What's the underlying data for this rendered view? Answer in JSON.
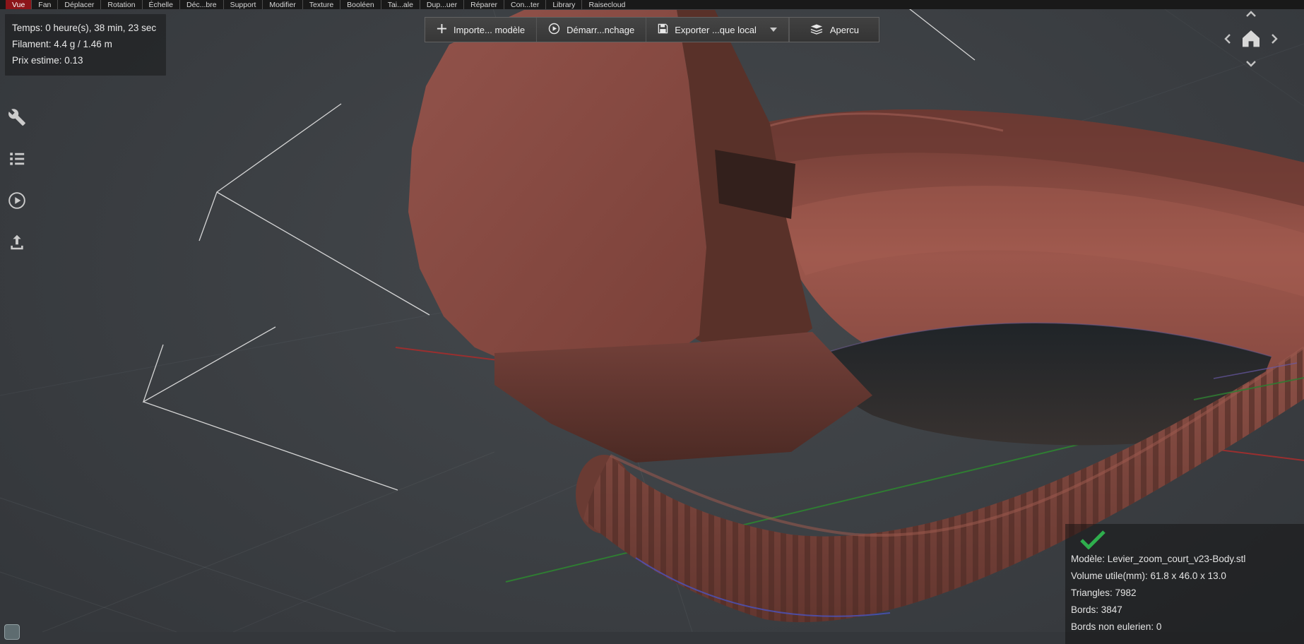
{
  "menu": {
    "items": [
      "Vue",
      "Fan",
      "Déplacer",
      "Rotation",
      "Échelle",
      "Déc...bre",
      "Support",
      "Modifier",
      "Texture",
      "Booléen",
      "Tai...ale",
      "Dup...uer",
      "Réparer",
      "Con...ter",
      "Library",
      "Raisecloud"
    ],
    "active_item": "Vue"
  },
  "stats_panel": {
    "time": "Temps: 0 heure(s), 38 min, 23 sec",
    "filament": "Filament: 4.4 g / 1.46 m",
    "price": "Prix estime: 0.13"
  },
  "toolbar": {
    "import_label": "Importe... modèle",
    "start_label": "Démarr...nchage",
    "export_label": "Exporter ...que local",
    "preview_label": "Apercu"
  },
  "model_info_panel": {
    "model": "Modèle: Levier_zoom_court_v23-Body.stl",
    "volume": "Volume utile(mm): 61.8 x 46.0 x 13.0",
    "triangles": "Triangles: 7982",
    "edges": "Bords: 3847",
    "non_euler_edges": "Bords non eulerien: 0"
  },
  "icons": {
    "toolbar": [
      "plus-icon",
      "play-circle-icon",
      "save-icon",
      "caret-down-icon",
      "layers-icon"
    ],
    "sidebar": [
      "wrench-icon",
      "list-icon",
      "play-circle-icon",
      "upload-icon"
    ],
    "nav": [
      "chevron-up-icon",
      "chevron-left-icon",
      "home-icon",
      "chevron-right-icon",
      "chevron-down-icon"
    ],
    "status": [
      "check-icon"
    ]
  },
  "colors": {
    "menu_active_bg": "#8c1519",
    "model_body": "#8f5048",
    "model_dark": "#56312b",
    "axis_red": "#9a2f2f",
    "axis_green": "#2f7d32",
    "success_check": "#2fae4d",
    "viewport_bg": "#3c4043"
  }
}
